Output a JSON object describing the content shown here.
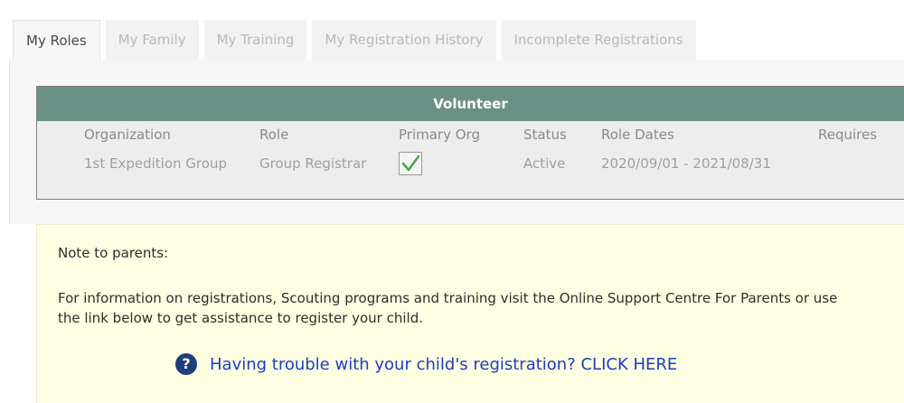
{
  "tabs": [
    {
      "label": "My Roles",
      "active": true
    },
    {
      "label": "My Family",
      "active": false
    },
    {
      "label": "My Training",
      "active": false
    },
    {
      "label": "My Registration History",
      "active": false
    },
    {
      "label": "Incomplete Registrations",
      "active": false
    }
  ],
  "volunteer": {
    "title": "Volunteer",
    "columns": {
      "organization": "Organization",
      "role": "Role",
      "primary_org": "Primary Org",
      "status": "Status",
      "role_dates": "Role Dates",
      "requires": "Requires"
    },
    "rows": [
      {
        "organization": "1st Expedition Group",
        "role": "Group Registrar",
        "primary_org_checked": true,
        "status": "Active",
        "role_dates": "2020/09/01 - 2021/08/31",
        "requires": ""
      }
    ]
  },
  "note": {
    "title": "Note to parents:",
    "body": "For information on registrations, Scouting programs and training visit the Online Support Centre For Parents or use the link below to get assistance to register your child.",
    "help_icon": "question-circle-icon",
    "help_link": "Having trouble with your child's registration? CLICK HERE"
  },
  "colors": {
    "header_bg": "#6a9186",
    "note_bg": "#fefee2",
    "link": "#1b3fbf",
    "check": "#4aa64a"
  }
}
